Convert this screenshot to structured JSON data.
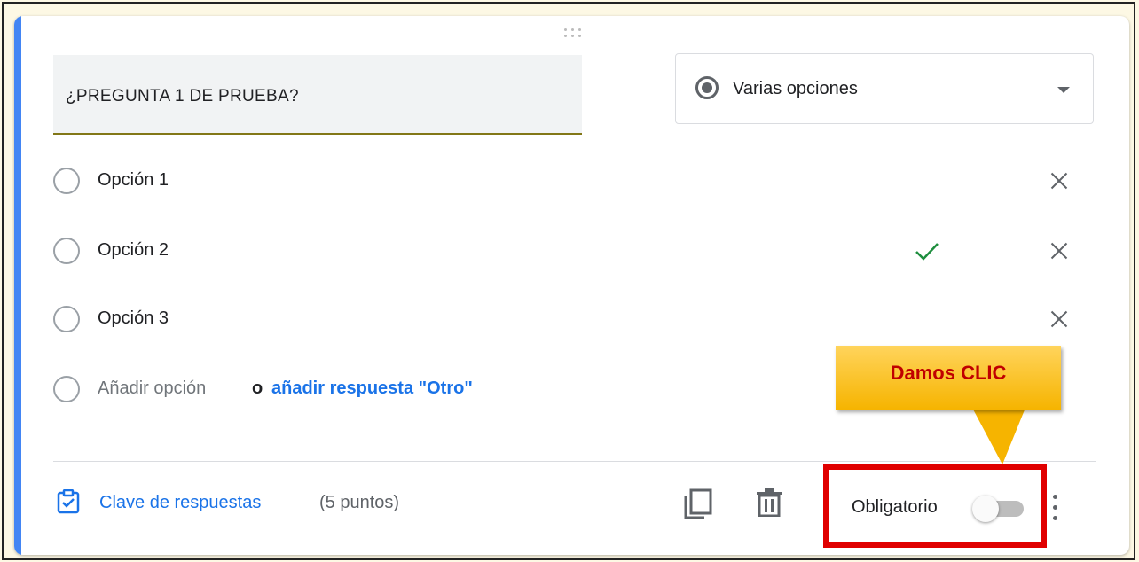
{
  "question": {
    "text": "¿PREGUNTA 1 DE PRUEBA?",
    "type_label": "Varias opciones"
  },
  "options": [
    {
      "label": "Opción 1",
      "correct": false
    },
    {
      "label": "Opción 2",
      "correct": true
    },
    {
      "label": "Opción 3",
      "correct": false
    }
  ],
  "add_option": {
    "label": "Añadir opción",
    "or": "o",
    "other_link": "añadir respuesta \"Otro\""
  },
  "footer": {
    "answer_key_label": "Clave de respuestas",
    "points": "(5 puntos)",
    "required_label": "Obligatorio",
    "required_on": false
  },
  "annotation": {
    "callout_text": "Damos CLIC"
  },
  "colors": {
    "accent": "#4285f4",
    "link": "#1a73e8",
    "check": "#1e8e3e",
    "highlight_box": "#e00000",
    "callout_bg": "#f6b400",
    "callout_text": "#c00000"
  }
}
